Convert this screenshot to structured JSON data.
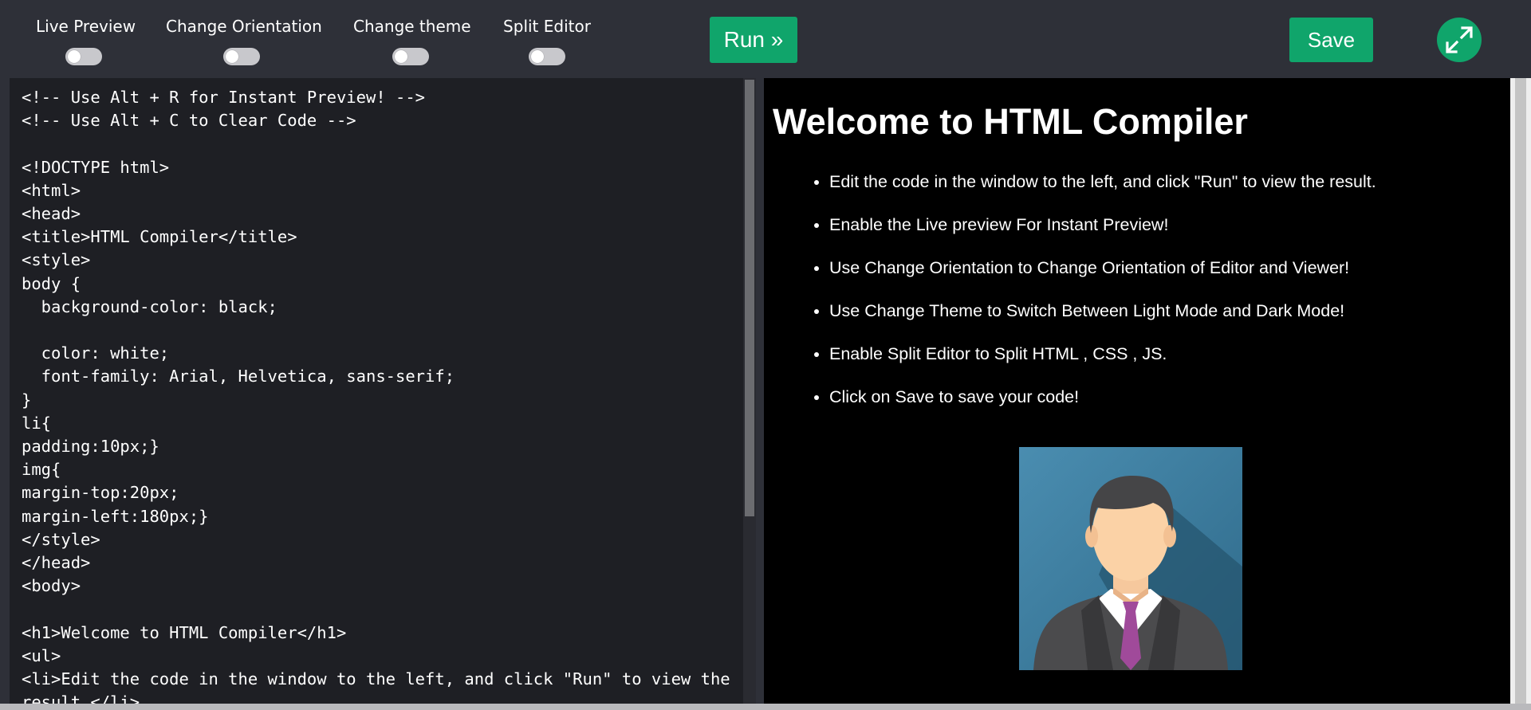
{
  "toolbar": {
    "live_preview_label": "Live Preview",
    "change_orientation_label": "Change Orientation",
    "change_theme_label": "Change theme",
    "split_editor_label": "Split Editor",
    "run_label": "Run »",
    "save_label": "Save",
    "expand_icon": "expand-icon",
    "accent_color": "#10a56b"
  },
  "editor": {
    "code": "<!-- Use Alt + R for Instant Preview! -->\n<!-- Use Alt + C to Clear Code -->\n\n<!DOCTYPE html>\n<html>\n<head>\n<title>HTML Compiler</title>\n<style>\nbody {\n  background-color: black;\n\n  color: white;\n  font-family: Arial, Helvetica, sans-serif;\n}\nli{\npadding:10px;}\nimg{\nmargin-top:20px;\nmargin-left:180px;}\n</style>\n</head>\n<body>\n\n<h1>Welcome to HTML Compiler</h1>\n<ul>\n<li>Edit the code in the window to the left, and click \"Run\" to view the\nresult.</li>"
  },
  "preview": {
    "heading": "Welcome to HTML Compiler",
    "items": [
      "Edit the code in the window to the left, and click \"Run\" to view the result.",
      "Enable the Live preview For Instant Preview!",
      "Use Change Orientation to Change Orientation of Editor and Viewer!",
      "Use Change Theme to Switch Between Light Mode and Dark Mode!",
      "Enable Split Editor to Split HTML , CSS , JS.",
      "Click on Save to save your code!"
    ],
    "avatar_icon": "businessman-avatar"
  }
}
